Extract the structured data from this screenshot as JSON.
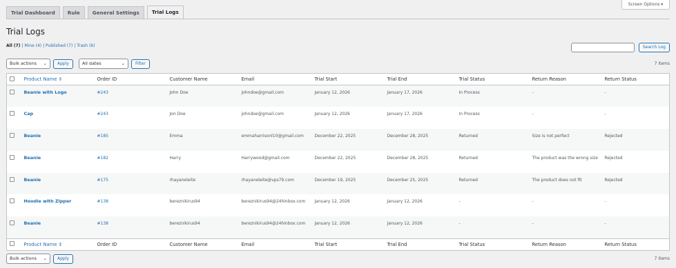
{
  "tabs": [
    "Trial Dashboard",
    "Rule",
    "General Settings",
    "Trial Logs"
  ],
  "screen_options": "Screen Options ▾",
  "page_title": "Trial Logs",
  "views": {
    "all": "All (7)",
    "mine": "Mine (4)",
    "published": "Published (7)",
    "trash": "Trash (6)",
    "sep": "|"
  },
  "search": {
    "placeholder": "",
    "button": "Search Log"
  },
  "top_nav": {
    "bulk_actions": "Bulk actions",
    "apply": "Apply",
    "dates": "All dates",
    "filter": "Filter",
    "items": "7 items"
  },
  "bottom_nav": {
    "bulk_actions": "Bulk actions",
    "apply": "Apply",
    "items": "7 items"
  },
  "columns": {
    "product": "Product Name ⇕",
    "order": "Order ID",
    "customer": "Customer Name",
    "email": "Email",
    "start": "Trial Start",
    "end": "Trial End",
    "status": "Trial Status",
    "reason": "Return Reason",
    "rstatus": "Return Status"
  },
  "rows": [
    {
      "product": "Beanie with Logo",
      "order": "#243",
      "customer": "John Doe",
      "email": "johndoe@gmail.com",
      "start": "January 12, 2026",
      "end": "January 17, 2026",
      "status": "In Process",
      "reason": "-",
      "rstatus": "-"
    },
    {
      "product": "Cap",
      "order": "#243",
      "customer": "Jon Doe",
      "email": "johndoe@gmail.com",
      "start": "January 12, 2026",
      "end": "January 17, 2026",
      "status": "In Process",
      "reason": "-",
      "rstatus": "-"
    },
    {
      "product": "Beanie",
      "order": "#185",
      "customer": "Emma",
      "email": "emmaharrisonl10@gmail.com",
      "start": "December 22, 2025",
      "end": "December 28, 2025",
      "status": "Returned",
      "reason": "Size is not perfect",
      "rstatus": "Rejected"
    },
    {
      "product": "Beanie",
      "order": "#182",
      "customer": "Harry",
      "email": "Harrywood@gmail.com",
      "start": "December 22, 2025",
      "end": "December 28, 2025",
      "status": "Returned",
      "reason": "The product was the wrong size",
      "rstatus": "Rejected"
    },
    {
      "product": "Beanie",
      "order": "#175",
      "customer": "rhayaneleite",
      "email": "rhayaneleite@vps79.com",
      "start": "December 19, 2025",
      "end": "December 25, 2025",
      "status": "Returned",
      "reason": "The product does not fit",
      "rstatus": "Rejected"
    },
    {
      "product": "Hoodie with Zipper",
      "order": "#138",
      "customer": "bereznikirus94",
      "email": "bereznikirus94@24hinbox.com",
      "start": "January 12, 2026",
      "end": "January 12, 2026",
      "status": "-",
      "reason": "-",
      "rstatus": "-"
    },
    {
      "product": "Beanie",
      "order": "#138",
      "customer": "bereznikirus94",
      "email": "bereznikirus94@24hinbox.com",
      "start": "January 12, 2026",
      "end": "January 12, 2026",
      "status": "-",
      "reason": "-",
      "rstatus": "-"
    }
  ]
}
